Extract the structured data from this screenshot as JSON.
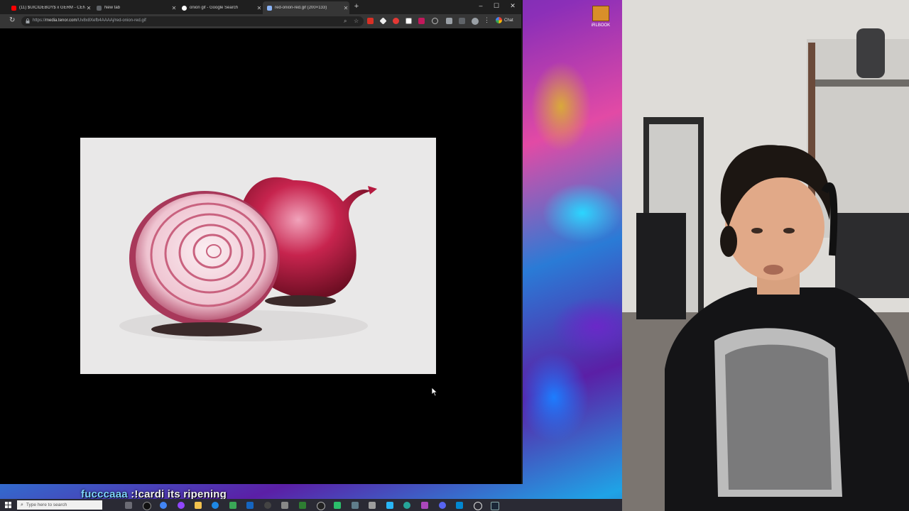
{
  "browser": {
    "tabs": [
      {
        "title": "(11) $UICIDEBOY$ x GERM - CENT",
        "color": "#ff0000",
        "active": false
      },
      {
        "title": "New tab",
        "color": "#8ab4f8",
        "active": false
      },
      {
        "title": "onion gif - Google Search",
        "color": "#ffffff",
        "active": false
      },
      {
        "title": "red-onion-red.gif (200×133)",
        "color": "#8ab4f8",
        "active": true
      }
    ],
    "new_tab": "+",
    "window_controls": {
      "minimize": "–",
      "maximize": "☐",
      "close": "✕"
    },
    "address": {
      "scheme": "https://",
      "host": "media.tenor.com",
      "path": "/Uv8x8Xefb4AAAAj/red-onion-red.gif"
    },
    "chat_label": "Chat"
  },
  "image": {
    "subject": "red onion gif"
  },
  "desktop": {
    "icon_label": "iRLBOOK"
  },
  "overlay": {
    "user": "fucccaaa",
    "message": ":!cardi its ripening"
  },
  "taskbar": {
    "search_placeholder": "Type here to search"
  }
}
